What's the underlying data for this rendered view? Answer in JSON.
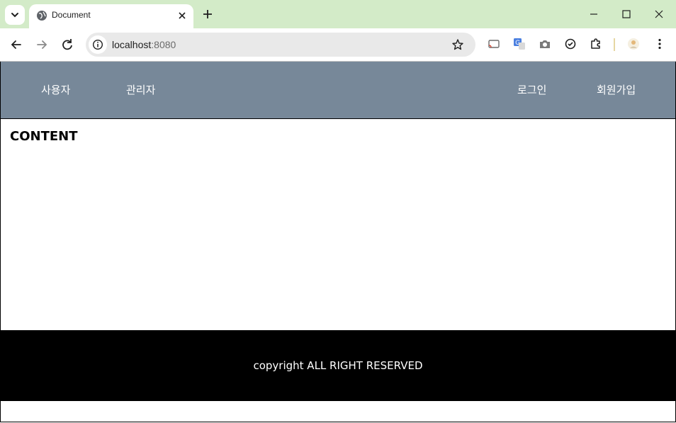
{
  "browser": {
    "tab": {
      "title": "Document"
    },
    "address_bar": {
      "host": "localhost",
      "port": ":8080"
    }
  },
  "site": {
    "nav": {
      "left": [
        "사용자",
        "관리자"
      ],
      "right": [
        "로그인",
        "회원가입"
      ]
    },
    "content_title": "CONTENT",
    "footer_text": "copyright ALL RIGHT RESERVED"
  },
  "colors": {
    "chrome_titlebar": "#d3ebc8",
    "nav_background": "#778899",
    "footer_background": "#000000"
  },
  "icons": [
    "tab-search-icon",
    "globe-icon",
    "close-icon",
    "plus-icon",
    "minimize-icon",
    "maximize-icon",
    "back-icon",
    "forward-icon",
    "reload-icon",
    "info-icon",
    "star-icon",
    "cast-icon",
    "translate-icon",
    "camera-icon",
    "sync-icon",
    "puzzle-icon",
    "profile-icon",
    "more-icon"
  ]
}
